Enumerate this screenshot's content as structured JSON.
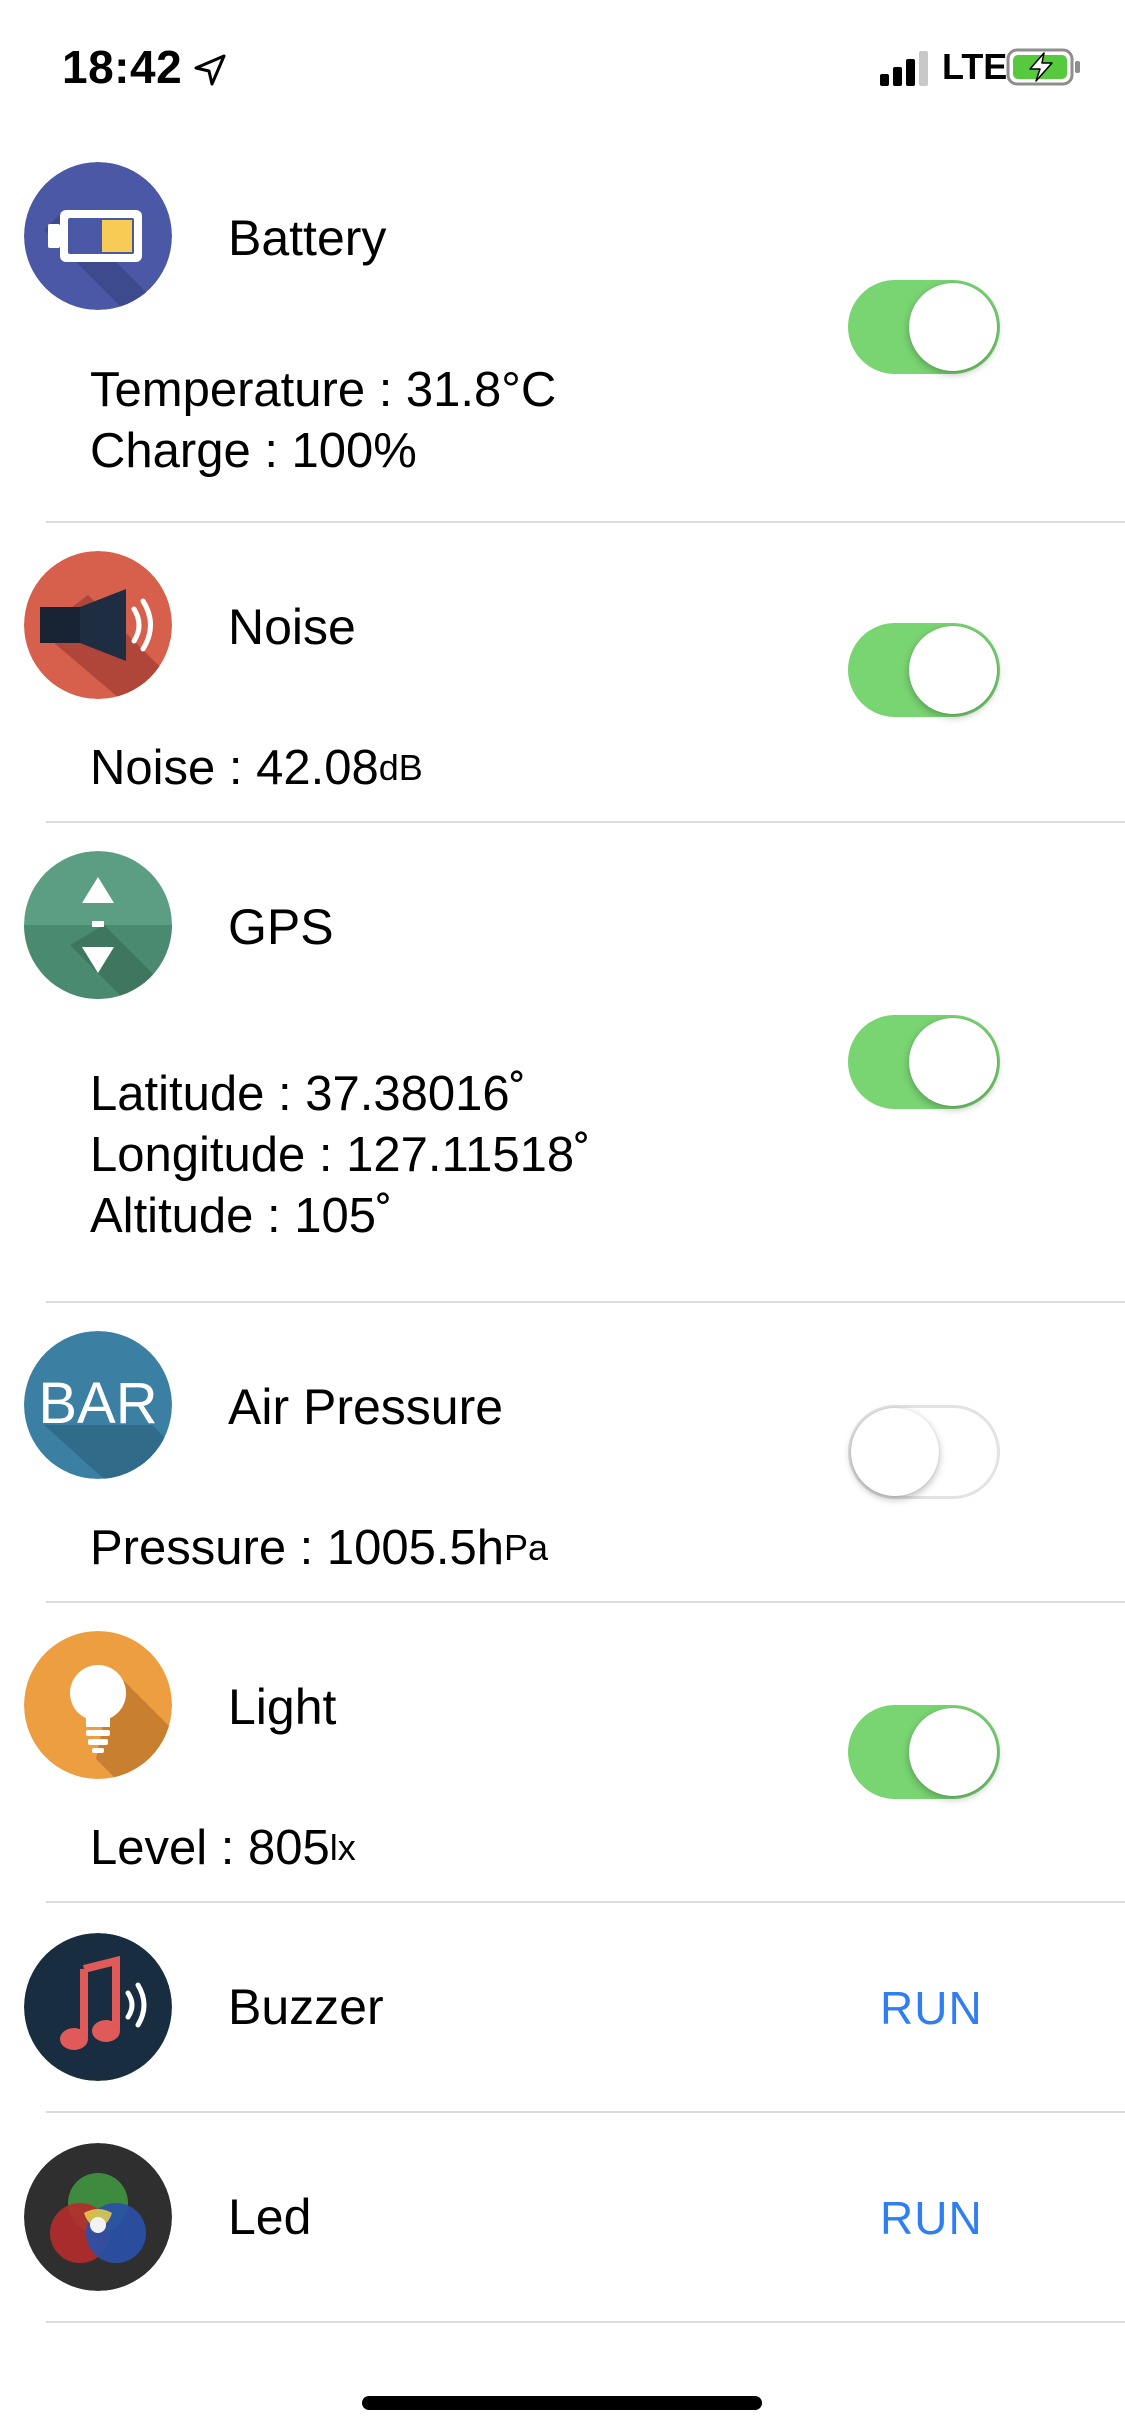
{
  "status_bar": {
    "time": "18:42",
    "network": "LTE",
    "location_icon": "location-arrow-icon",
    "signal_icon": "signal-bars-icon",
    "battery_icon": "battery-charging-icon"
  },
  "colors": {
    "switch_on": "#79d472",
    "run_link": "#2f7ff0",
    "divider": "#dcdcdc"
  },
  "sensors": [
    {
      "id": "battery",
      "title": "Battery",
      "icon": "battery-icon",
      "enabled": true,
      "lines": [
        {
          "label": "Temperature : 31.8°C"
        },
        {
          "label": "Charge : 100%"
        }
      ]
    },
    {
      "id": "noise",
      "title": "Noise",
      "icon": "speaker-icon",
      "enabled": true,
      "lines": [
        {
          "label": "Noise : 42.08",
          "unit": "dB"
        }
      ]
    },
    {
      "id": "gps",
      "title": "GPS",
      "icon": "gps-arrows-icon",
      "enabled": true,
      "lines": [
        {
          "label": "Latitude : 37.38016˚"
        },
        {
          "label": "Longitude : 127.11518˚"
        },
        {
          "label": "Altitude : 105˚"
        }
      ]
    },
    {
      "id": "air_pressure",
      "title": "Air Pressure",
      "icon": "bar-pressure-icon",
      "icon_text": "BAR",
      "enabled": false,
      "lines": [
        {
          "label": "Pressure : 1005.5h",
          "unit": "Pa"
        }
      ]
    },
    {
      "id": "light",
      "title": "Light",
      "icon": "lightbulb-icon",
      "enabled": true,
      "lines": [
        {
          "label": "Level : 805",
          "unit": "lx"
        }
      ]
    }
  ],
  "actions": [
    {
      "id": "buzzer",
      "title": "Buzzer",
      "icon": "music-note-icon",
      "button": "RUN"
    },
    {
      "id": "led",
      "title": "Led",
      "icon": "rgb-led-icon",
      "button": "RUN"
    }
  ]
}
